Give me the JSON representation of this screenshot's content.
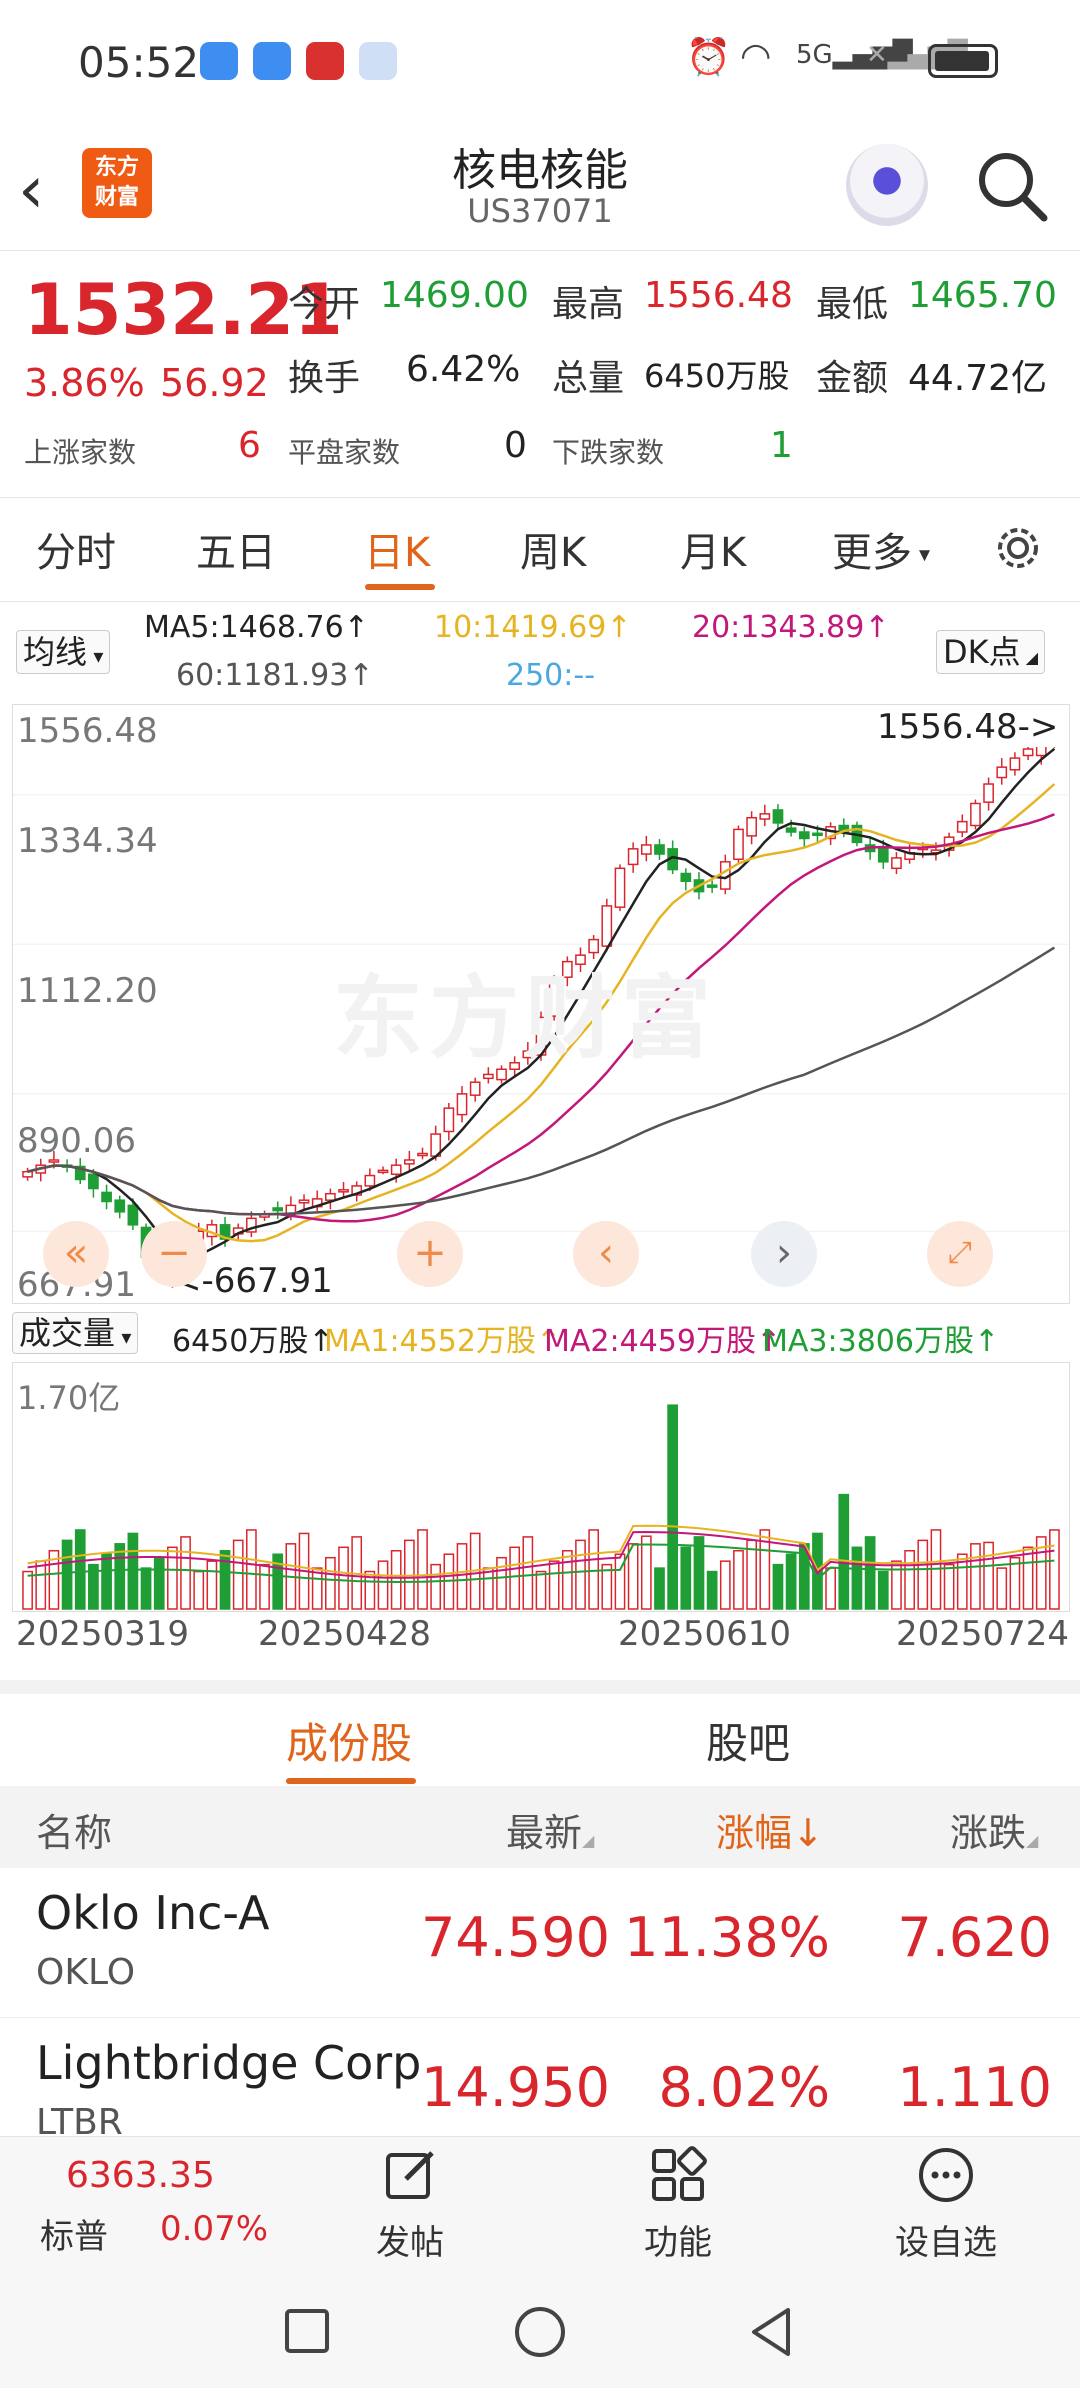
{
  "status": {
    "time": "05:52",
    "network": "5G"
  },
  "header": {
    "title": "核电核能",
    "code": "US37071",
    "logo": "东方财富",
    "back_icon": "back-arrow-icon",
    "search_icon": "search-icon"
  },
  "quote": {
    "price": "1532.21",
    "pct": "3.86%",
    "change": "56.92",
    "open_label": "今开",
    "open": "1469.00",
    "high_label": "最高",
    "high": "1556.48",
    "low_label": "最低",
    "low": "1465.70",
    "turnover_label": "换手",
    "turnover": "6.42%",
    "volume_label": "总量",
    "volume": "6450万股",
    "amount_label": "金额",
    "amount": "44.72亿",
    "up_label": "上涨家数",
    "up": "6",
    "flat_label": "平盘家数",
    "flat": "0",
    "down_label": "下跌家数",
    "down": "1"
  },
  "tabs": [
    "分时",
    "五日",
    "日K",
    "周K",
    "月K",
    "更多"
  ],
  "active_tab": "日K",
  "ma": {
    "selector": "均线",
    "ma5": "MA5:1468.76↑",
    "ma10": "10:1419.69↑",
    "ma20": "20:1343.89↑",
    "ma60": "60:1181.93↑",
    "ma250": "250:--",
    "dk": "DK点",
    "colors": {
      "ma5": "#222222",
      "ma10": "#e6b422",
      "ma20": "#c2187a",
      "ma60": "#555555",
      "ma250": "#4aa8e0"
    }
  },
  "kline": {
    "y_labels": [
      "1556.48",
      "1334.34",
      "1112.20",
      "890.06",
      "667.91"
    ],
    "high_mark": "1556.48->",
    "low_mark": "<-667.91",
    "watermark": "东方财富"
  },
  "volume": {
    "selector": "成交量",
    "current": "6450万股↑",
    "ma1": "MA1:4552万股↑",
    "ma2": "MA2:4459万股↑",
    "ma3": "MA3:3806万股↑",
    "max_label": "1.70亿"
  },
  "dates": [
    "20250319",
    "20250428",
    "20250610",
    "20250724"
  ],
  "chart_data": [
    {
      "type": "candlestick",
      "title": "核电核能 日K",
      "x_range": [
        "20250319",
        "20250724"
      ],
      "ylim": [
        667.91,
        1556.48
      ],
      "closes": [
        852,
        862,
        870,
        860,
        840,
        826,
        806,
        790,
        770,
        720,
        694,
        700,
        742,
        760,
        770,
        748,
        765,
        780,
        786,
        792,
        800,
        808,
        810,
        818,
        824,
        830,
        846,
        854,
        862,
        870,
        880,
        910,
        950,
        972,
        990,
        1002,
        1010,
        1020,
        1038,
        1090,
        1142,
        1176,
        1186,
        1210,
        1262,
        1320,
        1350,
        1356,
        1342,
        1318,
        1300,
        1284,
        1292,
        1330,
        1380,
        1398,
        1404,
        1390,
        1376,
        1366,
        1372,
        1384,
        1376,
        1360,
        1346,
        1330,
        1336,
        1344,
        1352,
        1348,
        1368,
        1392,
        1420,
        1450,
        1476,
        1490,
        1504,
        1520,
        1532
      ],
      "ma_values": {
        "MA5": "1468.76",
        "MA10": "1419.69",
        "MA20": "1343.89",
        "MA60": "1181.93"
      },
      "high": "1556.48",
      "low": "667.91"
    },
    {
      "type": "bar",
      "title": "成交量",
      "ylim": [
        0,
        170000000
      ],
      "max_label": "1.70亿",
      "last": "6450万股"
    }
  ],
  "subtabs": [
    "成份股",
    "股吧"
  ],
  "table": {
    "headers": {
      "name": "名称",
      "latest": "最新",
      "pct": "涨幅↓",
      "change": "涨跌"
    },
    "rows": [
      {
        "name": "Oklo Inc-A",
        "code": "OKLO",
        "latest": "74.590",
        "pct": "11.38%",
        "change": "7.620"
      },
      {
        "name": "Lightbridge Corp",
        "code": "LTBR",
        "latest": "14.950",
        "pct": "8.02%",
        "change": "1.110"
      }
    ]
  },
  "bottom": {
    "index_value": "6363.35",
    "index_name": "标普",
    "index_pct": "0.07%",
    "post": "发帖",
    "func": "功能",
    "fav": "设自选"
  }
}
